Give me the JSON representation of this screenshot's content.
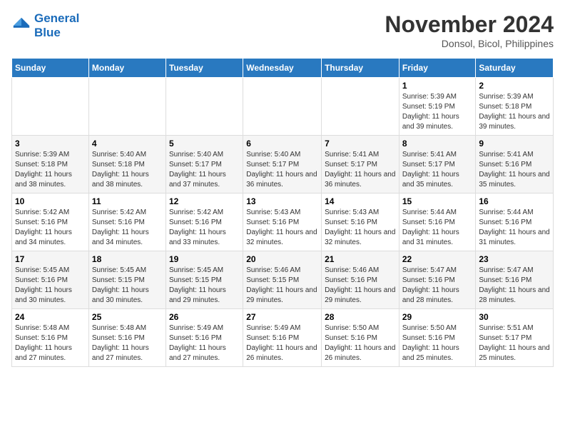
{
  "logo": {
    "line1": "General",
    "line2": "Blue"
  },
  "title": "November 2024",
  "location": "Donsol, Bicol, Philippines",
  "weekdays": [
    "Sunday",
    "Monday",
    "Tuesday",
    "Wednesday",
    "Thursday",
    "Friday",
    "Saturday"
  ],
  "weeks": [
    [
      {
        "day": "",
        "info": ""
      },
      {
        "day": "",
        "info": ""
      },
      {
        "day": "",
        "info": ""
      },
      {
        "day": "",
        "info": ""
      },
      {
        "day": "",
        "info": ""
      },
      {
        "day": "1",
        "info": "Sunrise: 5:39 AM\nSunset: 5:19 PM\nDaylight: 11 hours and 39 minutes."
      },
      {
        "day": "2",
        "info": "Sunrise: 5:39 AM\nSunset: 5:18 PM\nDaylight: 11 hours and 39 minutes."
      }
    ],
    [
      {
        "day": "3",
        "info": "Sunrise: 5:39 AM\nSunset: 5:18 PM\nDaylight: 11 hours and 38 minutes."
      },
      {
        "day": "4",
        "info": "Sunrise: 5:40 AM\nSunset: 5:18 PM\nDaylight: 11 hours and 38 minutes."
      },
      {
        "day": "5",
        "info": "Sunrise: 5:40 AM\nSunset: 5:17 PM\nDaylight: 11 hours and 37 minutes."
      },
      {
        "day": "6",
        "info": "Sunrise: 5:40 AM\nSunset: 5:17 PM\nDaylight: 11 hours and 36 minutes."
      },
      {
        "day": "7",
        "info": "Sunrise: 5:41 AM\nSunset: 5:17 PM\nDaylight: 11 hours and 36 minutes."
      },
      {
        "day": "8",
        "info": "Sunrise: 5:41 AM\nSunset: 5:17 PM\nDaylight: 11 hours and 35 minutes."
      },
      {
        "day": "9",
        "info": "Sunrise: 5:41 AM\nSunset: 5:16 PM\nDaylight: 11 hours and 35 minutes."
      }
    ],
    [
      {
        "day": "10",
        "info": "Sunrise: 5:42 AM\nSunset: 5:16 PM\nDaylight: 11 hours and 34 minutes."
      },
      {
        "day": "11",
        "info": "Sunrise: 5:42 AM\nSunset: 5:16 PM\nDaylight: 11 hours and 34 minutes."
      },
      {
        "day": "12",
        "info": "Sunrise: 5:42 AM\nSunset: 5:16 PM\nDaylight: 11 hours and 33 minutes."
      },
      {
        "day": "13",
        "info": "Sunrise: 5:43 AM\nSunset: 5:16 PM\nDaylight: 11 hours and 32 minutes."
      },
      {
        "day": "14",
        "info": "Sunrise: 5:43 AM\nSunset: 5:16 PM\nDaylight: 11 hours and 32 minutes."
      },
      {
        "day": "15",
        "info": "Sunrise: 5:44 AM\nSunset: 5:16 PM\nDaylight: 11 hours and 31 minutes."
      },
      {
        "day": "16",
        "info": "Sunrise: 5:44 AM\nSunset: 5:16 PM\nDaylight: 11 hours and 31 minutes."
      }
    ],
    [
      {
        "day": "17",
        "info": "Sunrise: 5:45 AM\nSunset: 5:16 PM\nDaylight: 11 hours and 30 minutes."
      },
      {
        "day": "18",
        "info": "Sunrise: 5:45 AM\nSunset: 5:15 PM\nDaylight: 11 hours and 30 minutes."
      },
      {
        "day": "19",
        "info": "Sunrise: 5:45 AM\nSunset: 5:15 PM\nDaylight: 11 hours and 29 minutes."
      },
      {
        "day": "20",
        "info": "Sunrise: 5:46 AM\nSunset: 5:15 PM\nDaylight: 11 hours and 29 minutes."
      },
      {
        "day": "21",
        "info": "Sunrise: 5:46 AM\nSunset: 5:16 PM\nDaylight: 11 hours and 29 minutes."
      },
      {
        "day": "22",
        "info": "Sunrise: 5:47 AM\nSunset: 5:16 PM\nDaylight: 11 hours and 28 minutes."
      },
      {
        "day": "23",
        "info": "Sunrise: 5:47 AM\nSunset: 5:16 PM\nDaylight: 11 hours and 28 minutes."
      }
    ],
    [
      {
        "day": "24",
        "info": "Sunrise: 5:48 AM\nSunset: 5:16 PM\nDaylight: 11 hours and 27 minutes."
      },
      {
        "day": "25",
        "info": "Sunrise: 5:48 AM\nSunset: 5:16 PM\nDaylight: 11 hours and 27 minutes."
      },
      {
        "day": "26",
        "info": "Sunrise: 5:49 AM\nSunset: 5:16 PM\nDaylight: 11 hours and 27 minutes."
      },
      {
        "day": "27",
        "info": "Sunrise: 5:49 AM\nSunset: 5:16 PM\nDaylight: 11 hours and 26 minutes."
      },
      {
        "day": "28",
        "info": "Sunrise: 5:50 AM\nSunset: 5:16 PM\nDaylight: 11 hours and 26 minutes."
      },
      {
        "day": "29",
        "info": "Sunrise: 5:50 AM\nSunset: 5:16 PM\nDaylight: 11 hours and 25 minutes."
      },
      {
        "day": "30",
        "info": "Sunrise: 5:51 AM\nSunset: 5:17 PM\nDaylight: 11 hours and 25 minutes."
      }
    ]
  ]
}
